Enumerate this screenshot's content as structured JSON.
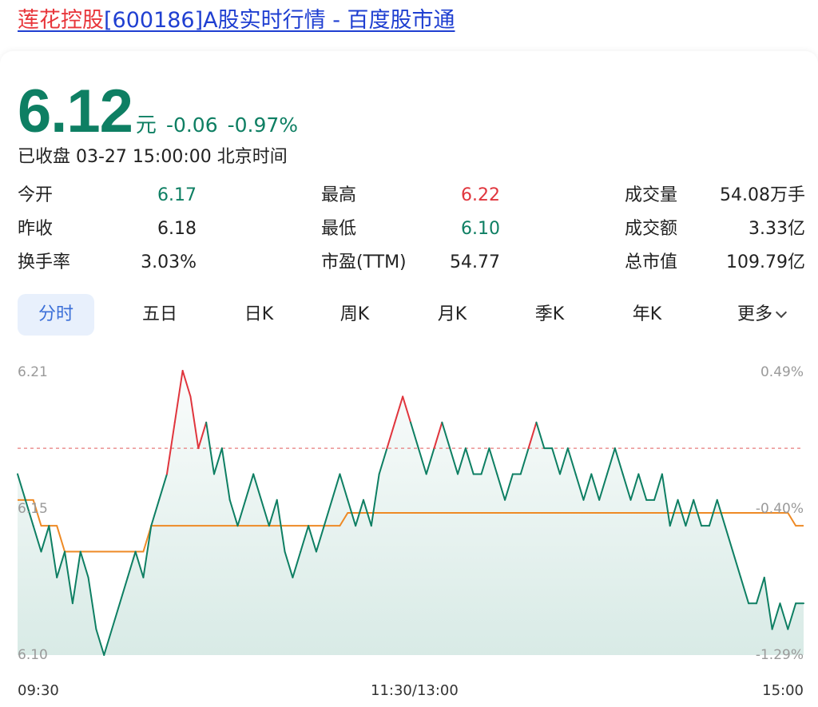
{
  "page": {
    "title_highlight": "莲花控股",
    "title_rest": "[600186]A股实时行情 - 百度股市通"
  },
  "quote": {
    "price": "6.12",
    "unit": "元",
    "change": "-0.06",
    "change_pct": "-0.97%",
    "status": "已收盘 03-27 15:00:00 北京时间"
  },
  "colors": {
    "down": "#0e7f63",
    "up": "#e0353d",
    "avg": "#ee8a25",
    "accent": "#3b6fd8"
  },
  "stats": [
    [
      {
        "label": "今开",
        "value": "6.17",
        "tone": "green"
      },
      {
        "label": "最高",
        "value": "6.22",
        "tone": "red"
      },
      {
        "label": "成交量",
        "value": "54.08万手",
        "tone": "black"
      }
    ],
    [
      {
        "label": "昨收",
        "value": "6.18",
        "tone": "black"
      },
      {
        "label": "最低",
        "value": "6.10",
        "tone": "green"
      },
      {
        "label": "成交额",
        "value": "3.33亿",
        "tone": "black"
      }
    ],
    [
      {
        "label": "换手率",
        "value": "3.03%",
        "tone": "black"
      },
      {
        "label": "市盈(TTM)",
        "value": "54.77",
        "tone": "black"
      },
      {
        "label": "总市值",
        "value": "109.79亿",
        "tone": "black"
      }
    ]
  ],
  "tabs": [
    {
      "label": "分时",
      "active": true
    },
    {
      "label": "五日",
      "active": false
    },
    {
      "label": "日K",
      "active": false
    },
    {
      "label": "周K",
      "active": false
    },
    {
      "label": "月K",
      "active": false
    },
    {
      "label": "季K",
      "active": false
    },
    {
      "label": "年K",
      "active": false
    },
    {
      "label": "更多",
      "active": false,
      "icon": "chevron-down-icon"
    }
  ],
  "chart_data": {
    "type": "line",
    "prev_close": 6.18,
    "ylim": [
      6.1,
      6.21
    ],
    "y_ticks_left": [
      "6.21",
      "6.15",
      "6.10"
    ],
    "y_ticks_right": [
      "0.49%",
      "-0.40%",
      "-1.29%"
    ],
    "x_ticks": [
      "09:30",
      "11:30/13:00",
      "15:00"
    ],
    "series": [
      {
        "values": [
          6.17,
          6.16,
          6.15,
          6.14,
          6.15,
          6.13,
          6.14,
          6.12,
          6.14,
          6.13,
          6.11,
          6.1,
          6.11,
          6.12,
          6.13,
          6.14,
          6.13,
          6.15,
          6.16,
          6.17,
          6.19,
          6.21,
          6.2,
          6.18,
          6.19,
          6.17,
          6.18,
          6.16,
          6.15,
          6.16,
          6.17,
          6.16,
          6.15,
          6.16,
          6.14,
          6.13,
          6.14,
          6.15,
          6.14,
          6.15,
          6.16,
          6.17,
          6.16,
          6.15,
          6.16,
          6.15,
          6.17,
          6.18,
          6.19,
          6.2,
          6.19,
          6.18,
          6.17,
          6.18,
          6.19,
          6.18,
          6.17,
          6.18,
          6.17,
          6.17,
          6.18,
          6.17,
          6.16,
          6.17,
          6.17,
          6.18,
          6.19,
          6.18,
          6.18,
          6.17,
          6.18,
          6.17,
          6.16,
          6.17,
          6.16,
          6.17,
          6.18,
          6.17,
          6.16,
          6.17,
          6.16,
          6.16,
          6.17,
          6.15,
          6.16,
          6.15,
          6.16,
          6.15,
          6.15,
          6.16,
          6.15,
          6.14,
          6.13,
          6.12,
          6.12,
          6.13,
          6.11,
          6.12,
          6.11,
          6.12,
          6.12
        ]
      },
      {
        "values": [
          6.16,
          6.16,
          6.16,
          6.15,
          6.15,
          6.15,
          6.14,
          6.14,
          6.14,
          6.14,
          6.14,
          6.14,
          6.14,
          6.14,
          6.14,
          6.14,
          6.14,
          6.15,
          6.15,
          6.15,
          6.15,
          6.15,
          6.15,
          6.15,
          6.15,
          6.15,
          6.15,
          6.15,
          6.15,
          6.15,
          6.15,
          6.15,
          6.15,
          6.15,
          6.15,
          6.15,
          6.15,
          6.15,
          6.15,
          6.15,
          6.15,
          6.15,
          6.155,
          6.155,
          6.155,
          6.155,
          6.155,
          6.155,
          6.155,
          6.155,
          6.155,
          6.155,
          6.155,
          6.155,
          6.155,
          6.155,
          6.155,
          6.155,
          6.155,
          6.155,
          6.155,
          6.155,
          6.155,
          6.155,
          6.155,
          6.155,
          6.155,
          6.155,
          6.155,
          6.155,
          6.155,
          6.155,
          6.155,
          6.155,
          6.155,
          6.155,
          6.155,
          6.155,
          6.155,
          6.155,
          6.155,
          6.155,
          6.155,
          6.155,
          6.155,
          6.155,
          6.155,
          6.155,
          6.155,
          6.155,
          6.155,
          6.155,
          6.155,
          6.155,
          6.155,
          6.155,
          6.155,
          6.155,
          6.155,
          6.15,
          6.15
        ]
      }
    ]
  }
}
